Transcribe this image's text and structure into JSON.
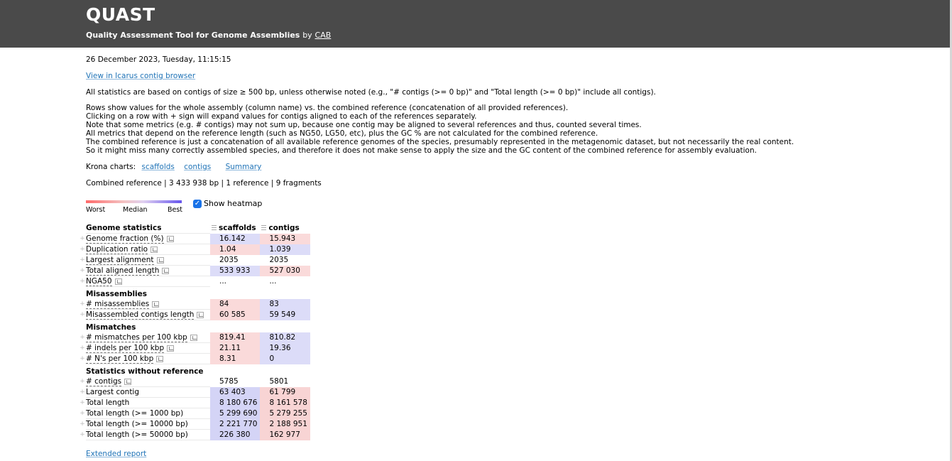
{
  "header": {
    "title": "QUAST",
    "subtitle": "Quality Assessment Tool for Genome Assemblies",
    "by": "by",
    "author_link": "CAB"
  },
  "date": "26 December 2023, Tuesday, 11:15:15",
  "icarus_link": "View in Icarus contig browser",
  "note_all_stats": "All statistics are based on contigs of size ≥ 500 bp, unless otherwise noted (e.g., \"# contigs (>= 0 bp)\" and \"Total length (>= 0 bp)\" include all contigs).",
  "notes": [
    "Rows show values for the whole assembly (column name) vs. the combined reference (concatenation of all provided references).",
    "Clicking on a row with + sign will expand values for contigs aligned to each of the references separately.",
    "Note that some metrics (e.g. # contigs) may not sum up, because one contig may be aligned to several references and thus, counted several times.",
    "All metrics that depend on the reference length (such as NG50, LG50, etc), plus the GC % are not calculated for the combined reference.",
    "The combined reference is just a concatenation of all available reference genomes of the species, presumably represented in the metagenomic dataset, but not necessarily the real content.",
    "So it might miss many correctly assembled species, and therefore it does not make sense to apply the size and the GC content of the combined reference for assembly evaluation."
  ],
  "krona": {
    "label": "Krona charts:",
    "links": [
      "scaffolds",
      "contigs",
      "Summary"
    ]
  },
  "combined_reference": "Combined reference | 3 433 938 bp | 1 reference | 9 fragments",
  "heatmap": {
    "worst": "Worst",
    "median": "Median",
    "best": "Best",
    "show_label": "Show heatmap",
    "checked": true,
    "colors": {
      "worst": "#ff6b6b",
      "best": "#6655ee"
    }
  },
  "table": {
    "columns": [
      "scaffolds",
      "contigs"
    ],
    "sections": [
      {
        "title": "Genome statistics",
        "rows": [
          {
            "name": "Genome fraction (%)",
            "values": [
              "16.142",
              "15.943"
            ]
          },
          {
            "name": "Duplication ratio",
            "values": [
              "1.04",
              "1.039"
            ]
          },
          {
            "name": "Largest alignment",
            "values": [
              "2035",
              "2035"
            ]
          },
          {
            "name": "Total aligned length",
            "values": [
              "533 933",
              "527 030"
            ]
          },
          {
            "name": "NGA50",
            "values": [
              "...",
              "..."
            ]
          }
        ]
      },
      {
        "title": "Misassemblies",
        "rows": [
          {
            "name": "# misassemblies",
            "values": [
              "84",
              "83"
            ]
          },
          {
            "name": "Misassembled contigs length",
            "values": [
              "60 585",
              "59 549"
            ]
          }
        ]
      },
      {
        "title": "Mismatches",
        "rows": [
          {
            "name": "# mismatches per 100 kbp",
            "values": [
              "819.41",
              "810.82"
            ]
          },
          {
            "name": "# indels per 100 kbp",
            "values": [
              "21.11",
              "19.36"
            ]
          },
          {
            "name": "# N's per 100 kbp",
            "values": [
              "8.31",
              "0"
            ]
          }
        ]
      },
      {
        "title": "Statistics without reference",
        "rows": [
          {
            "name": "# contigs",
            "values": [
              "5785",
              "5801"
            ]
          },
          {
            "name": "Largest contig",
            "values": [
              "63 403",
              "61 799"
            ]
          },
          {
            "name": "Total length",
            "values": [
              "8 180 676",
              "8 161 578"
            ]
          },
          {
            "name": "Total length (>= 1000 bp)",
            "values": [
              "5 299 690",
              "5 279 255"
            ]
          },
          {
            "name": "Total length (>= 10000 bp)",
            "values": [
              "2 221 770",
              "2 188 951"
            ]
          },
          {
            "name": "Total length (>= 50000 bp)",
            "values": [
              "226 380",
              "162 977"
            ]
          }
        ]
      }
    ]
  },
  "extended_report": "Extended report"
}
